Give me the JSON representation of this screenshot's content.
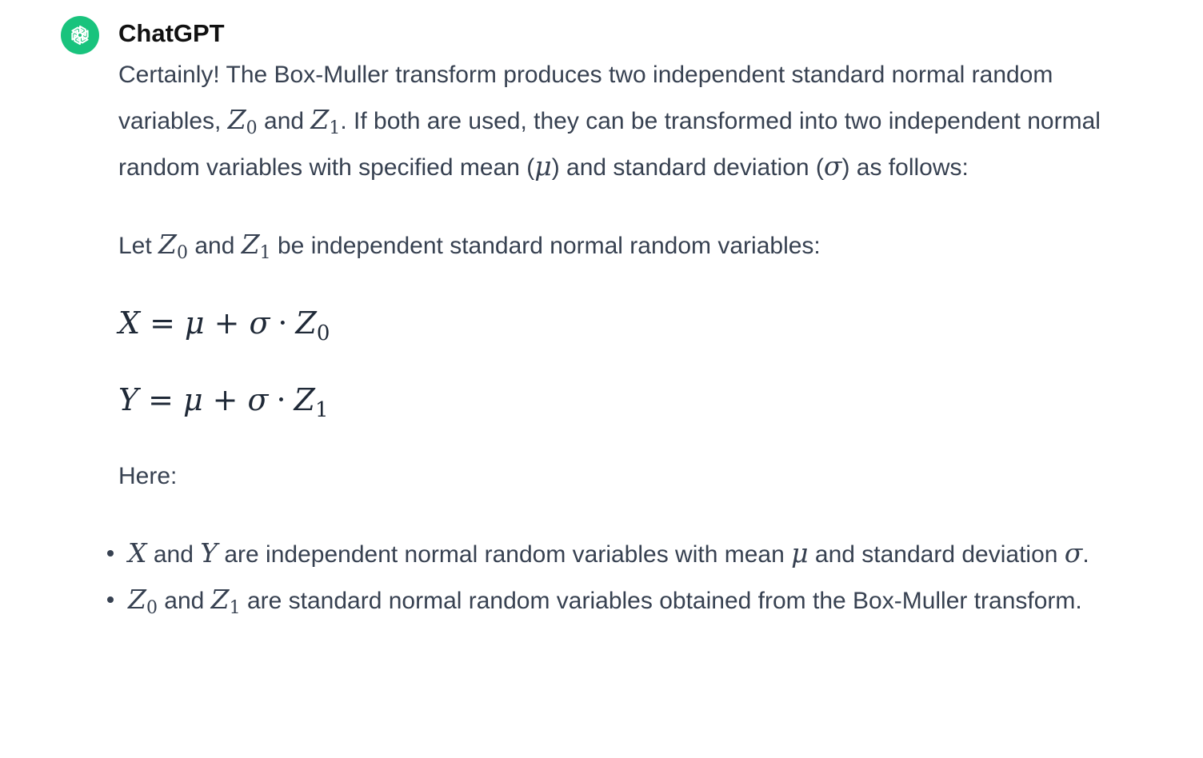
{
  "author": "ChatGPT",
  "brand_color": "#19c37d",
  "avatar_icon": "openai-logo-icon",
  "intro": {
    "t1": "Certainly! The Box-Muller transform produces two independent standard normal random variables, ",
    "t2": " and ",
    "t3": ". If both are used, they can be transformed into two independent normal random variables with specified mean (",
    "t4": ") and standard deviation (",
    "t5": ") as follows:"
  },
  "let": {
    "t1": "Let ",
    "t2": " and ",
    "t3": " be independent standard normal random variables:"
  },
  "symbols": {
    "Z": "Z",
    "sub0": "0",
    "sub1": "1",
    "mu": "μ",
    "sigma": "σ",
    "X": "X",
    "Y": "Y",
    "eq": "=",
    "plus": "+",
    "cdot": "·"
  },
  "here": "Here:",
  "bullet1": {
    "t1": " and ",
    "t2": " are independent normal random variables with mean ",
    "t3": " and standard deviation ",
    "t4": "."
  },
  "bullet2": {
    "t1": " and ",
    "t2": " are standard normal random variables obtained from the Box-Muller transform."
  }
}
